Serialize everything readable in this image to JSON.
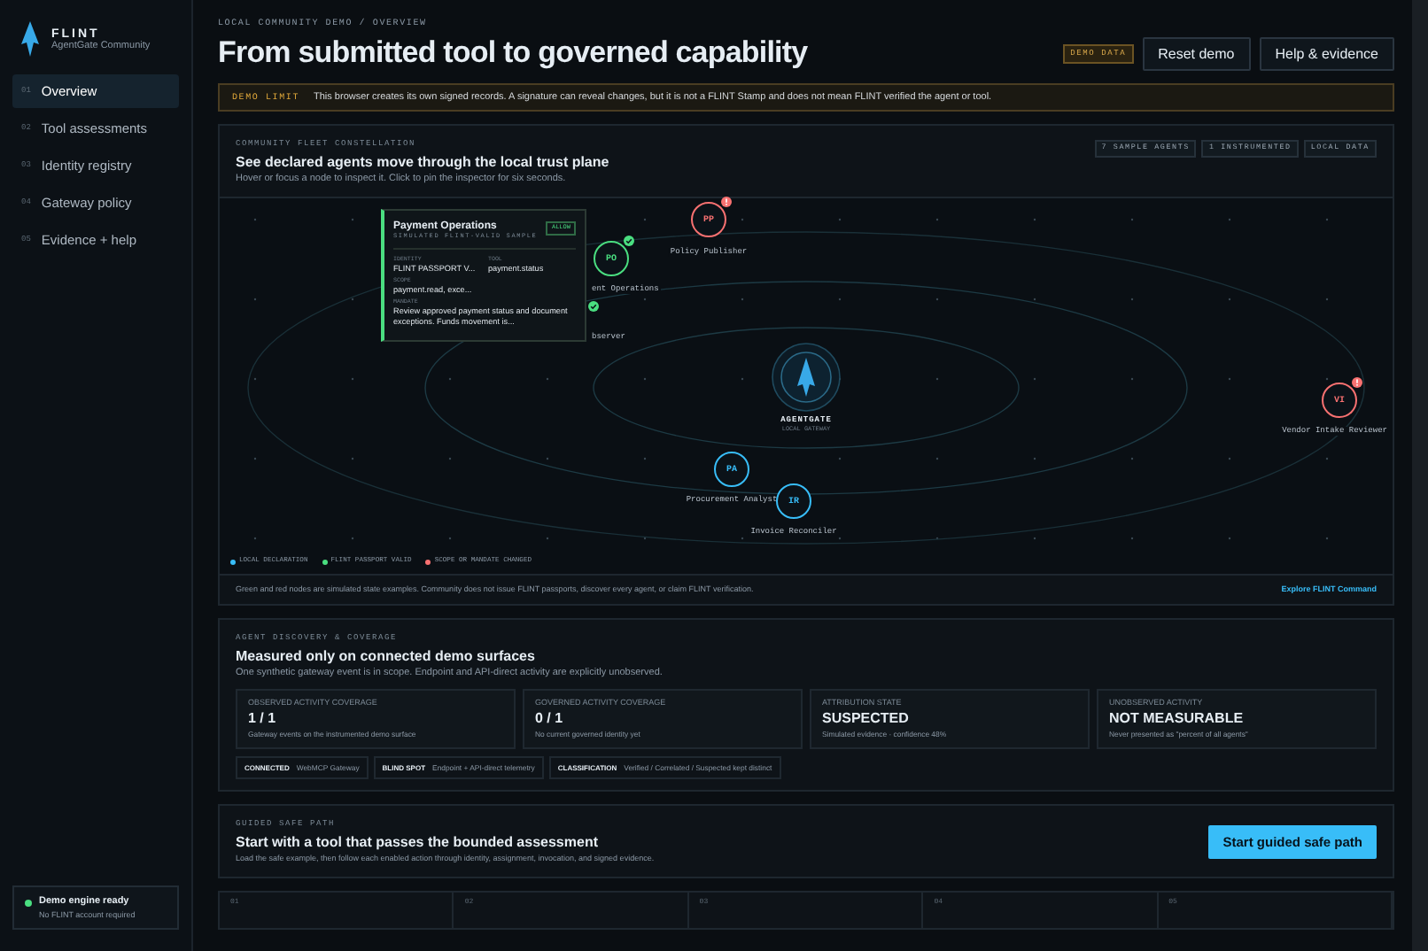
{
  "brand": {
    "name": "FLINT",
    "subtitle": "AgentGate Community"
  },
  "nav": [
    {
      "number": "01",
      "label": "Overview",
      "selected": true
    },
    {
      "number": "02",
      "label": "Tool assessments",
      "selected": false
    },
    {
      "number": "03",
      "label": "Identity registry",
      "selected": false
    },
    {
      "number": "04",
      "label": "Gateway policy",
      "selected": false
    },
    {
      "number": "05",
      "label": "Evidence + help",
      "selected": false
    }
  ],
  "engine_status": {
    "title": "Demo engine ready",
    "note": "No FLINT account required"
  },
  "breadcrumb": "LOCAL COMMUNITY DEMO / OVERVIEW",
  "title": "From submitted tool to governed capability",
  "header_badge": "DEMO DATA",
  "buttons": [
    "Reset demo",
    "Help & evidence"
  ],
  "notice": {
    "tag": "DEMO LIMIT",
    "text": "This browser creates its own signed records. A signature can reveal changes, but it is not a FLINT Stamp and does not mean FLINT verified the agent or tool."
  },
  "constellation": {
    "eyebrow": "COMMUNITY FLEET CONSTELLATION",
    "heading": "See declared agents move through the local trust plane",
    "hint": "Hover or focus a node to inspect it. Click to pin the inspector for six seconds.",
    "chips": [
      "7 SAMPLE AGENTS",
      "1 INSTRUMENTED",
      "LOCAL DATA"
    ],
    "gateway": {
      "name": "AGENTGATE",
      "note": "LOCAL GATEWAY"
    },
    "nodes": [
      {
        "initials": "PP",
        "label": "Policy Publisher",
        "color": "#f87171"
      },
      {
        "initials": "PO",
        "label": "ent Operations",
        "color": "#4ade80"
      },
      {
        "label": "bserver",
        "color": "#4ade80"
      },
      {
        "initials": "PA",
        "label": "Procurement Analyst",
        "color": "#38bdf8"
      },
      {
        "initials": "IR",
        "label": "Invoice Reconciler",
        "color": "#38bdf8"
      },
      {
        "initials": "VI",
        "label": "Vendor Intake Reviewer",
        "color": "#f87171"
      }
    ],
    "inspector": {
      "name": "Payment Operations",
      "subtitle": "SIMULATED FLINT-VALID SAMPLE",
      "decision": "ALLOW",
      "fields": [
        {
          "label": "IDENTITY",
          "value": "FLINT PASSPORT V..."
        },
        {
          "label": "TOOL",
          "value": "payment.status"
        },
        {
          "label": "SCOPE",
          "value": "payment.read, exce..."
        }
      ],
      "mandate_label": "MANDATE",
      "mandate": "Review approved payment status and document exceptions. Funds movement is..."
    },
    "legend": [
      {
        "label": "LOCAL DECLARATION",
        "color": "#38bdf8"
      },
      {
        "label": "FLINT PASSPORT VALID",
        "color": "#4ade80"
      },
      {
        "label": "SCOPE OR MANDATE CHANGED",
        "color": "#f87171"
      }
    ],
    "footnote": "Green and red nodes are simulated state examples. Community does not issue FLINT passports, discover every agent, or claim FLINT verification.",
    "link": "Explore FLINT Command"
  },
  "coverage": {
    "eyebrow": "AGENT DISCOVERY & COVERAGE",
    "heading": "Measured only on connected demo surfaces",
    "subtitle": "One synthetic gateway event is in scope. Endpoint and API-direct activity are explicitly unobserved.",
    "stats": [
      {
        "label": "OBSERVED ACTIVITY COVERAGE",
        "value": "1 / 1",
        "note": "Gateway events on the instrumented demo surface"
      },
      {
        "label": "GOVERNED ACTIVITY COVERAGE",
        "value": "0 / 1",
        "note": "No current governed identity yet"
      },
      {
        "label": "ATTRIBUTION STATE",
        "value": "SUSPECTED",
        "note": "Simulated evidence · confidence 48%"
      },
      {
        "label": "UNOBSERVED ACTIVITY",
        "value": "NOT MEASURABLE",
        "note": "Never presented as \"percent of all agents\""
      }
    ],
    "chips": [
      {
        "label": "CONNECTED",
        "text": "WebMCP Gateway"
      },
      {
        "label": "BLIND SPOT",
        "text": "Endpoint + API-direct telemetry"
      },
      {
        "label": "CLASSIFICATION",
        "text": "Verified / Correlated / Suspected kept distinct"
      }
    ]
  },
  "guided": {
    "eyebrow": "GUIDED SAFE PATH",
    "heading": "Start with a tool that passes the bounded assessment",
    "text": "Load the safe example, then follow each enabled action through identity, assignment, invocation, and signed evidence.",
    "button": "Start guided safe path"
  },
  "steps": [
    {
      "number": "01"
    },
    {
      "number": "02"
    },
    {
      "number": "03"
    },
    {
      "number": "04"
    },
    {
      "number": "05"
    }
  ]
}
